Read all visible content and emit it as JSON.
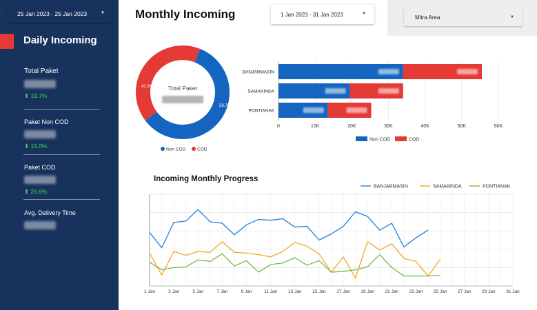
{
  "sidebar": {
    "date_range": "25 Jan 2023 - 25 Jan 2023",
    "title": "Daily Incoming",
    "metrics": [
      {
        "label": "Total Paket",
        "change": "19.7%"
      },
      {
        "label": "Paket Non COD",
        "change": "15.0%"
      },
      {
        "label": "Paket COD",
        "change": "26.6%"
      },
      {
        "label": "Avg. Delivery Time",
        "change": null
      }
    ]
  },
  "header": {
    "title": "Monthly Incoming",
    "date_filter": "1 Jan 2023 - 31 Jan 2023",
    "area_filter": "Mitra Area"
  },
  "colors": {
    "non_cod": "#1565c0",
    "cod": "#e53935",
    "banjarmasin": "#1e7fe0",
    "samarinda": "#f2a81d",
    "pontianak": "#77b940",
    "sidebar": "#17325c"
  },
  "chart_data": [
    {
      "type": "pie",
      "center_label": "Total Paket",
      "slices": [
        {
          "name": "Non COD",
          "value": 58.7,
          "label": "58.7%",
          "color": "#1565c0"
        },
        {
          "name": "COD",
          "value": 41.3,
          "label": "41.3%",
          "color": "#e53935"
        }
      ],
      "legend": "bottom"
    },
    {
      "type": "bar",
      "orientation": "horizontal",
      "stacked": true,
      "categories": [
        "BANJARMASIN",
        "SAMARINDA",
        "PONTIANAK"
      ],
      "series": [
        {
          "name": "Non COD",
          "values": [
            34000,
            19500,
            13500
          ],
          "color": "#1565c0"
        },
        {
          "name": "COD",
          "values": [
            21500,
            14500,
            11800
          ],
          "color": "#e53935"
        }
      ],
      "xlim": [
        0,
        60000
      ],
      "ticks": [
        "0",
        "10K",
        "20K",
        "30K",
        "40K",
        "50K",
        "60K"
      ],
      "tick_values": [
        0,
        10000,
        20000,
        30000,
        40000,
        50000,
        60000
      ],
      "legend": "bottom"
    },
    {
      "type": "line",
      "title": "Incoming Monthly Progress",
      "x": [
        "1 Jan",
        "2 Jan",
        "3 Jan",
        "4 Jan",
        "5 Jan",
        "6 Jan",
        "7 Jan",
        "8 Jan",
        "9 Jan",
        "10 Jan",
        "11 Jan",
        "12 Jan",
        "13 Jan",
        "14 Jan",
        "15 Jan",
        "16 Jan",
        "17 Jan",
        "18 Jan",
        "19 Jan",
        "20 Jan",
        "21 Jan",
        "22 Jan",
        "23 Jan",
        "24 Jan",
        "25 Jan",
        "26 Jan",
        "27 Jan",
        "28 Jan",
        "29 Jan",
        "30 Jan",
        "31 Jan"
      ],
      "x_tick_labels": [
        "1 Jan",
        "3 Jan",
        "5 Jan",
        "7 Jan",
        "9 Jan",
        "11 Jan",
        "13 Jan",
        "15 Jan",
        "17 Jan",
        "19 Jan",
        "21 Jan",
        "23 Jan",
        "25 Jan",
        "27 Jan",
        "29 Jan",
        "31 Jan"
      ],
      "series": [
        {
          "name": "BANJARMASIN",
          "color": "#1e7fe0",
          "values": [
            70,
            50,
            83,
            85,
            100,
            84,
            82,
            67,
            80,
            87,
            86,
            88,
            77,
            78,
            60,
            68,
            78,
            97,
            91,
            73,
            82,
            51,
            63,
            73
          ]
        },
        {
          "name": "SAMARINDA",
          "color": "#f2a81d",
          "values": [
            43,
            14,
            45,
            40,
            45,
            44,
            58,
            44,
            43,
            41,
            38,
            45,
            57,
            52,
            42,
            18,
            38,
            10,
            58,
            47,
            55,
            36,
            32,
            13,
            35
          ]
        },
        {
          "name": "PONTIANAK",
          "color": "#77b940",
          "values": [
            31,
            21,
            24,
            25,
            34,
            32,
            42,
            26,
            33,
            18,
            28,
            30,
            37,
            27,
            33,
            18,
            19,
            21,
            25,
            41,
            24,
            13,
            13,
            13,
            14
          ]
        }
      ],
      "ylim": [
        0,
        120
      ],
      "legend": "top-right",
      "grid": true
    }
  ]
}
